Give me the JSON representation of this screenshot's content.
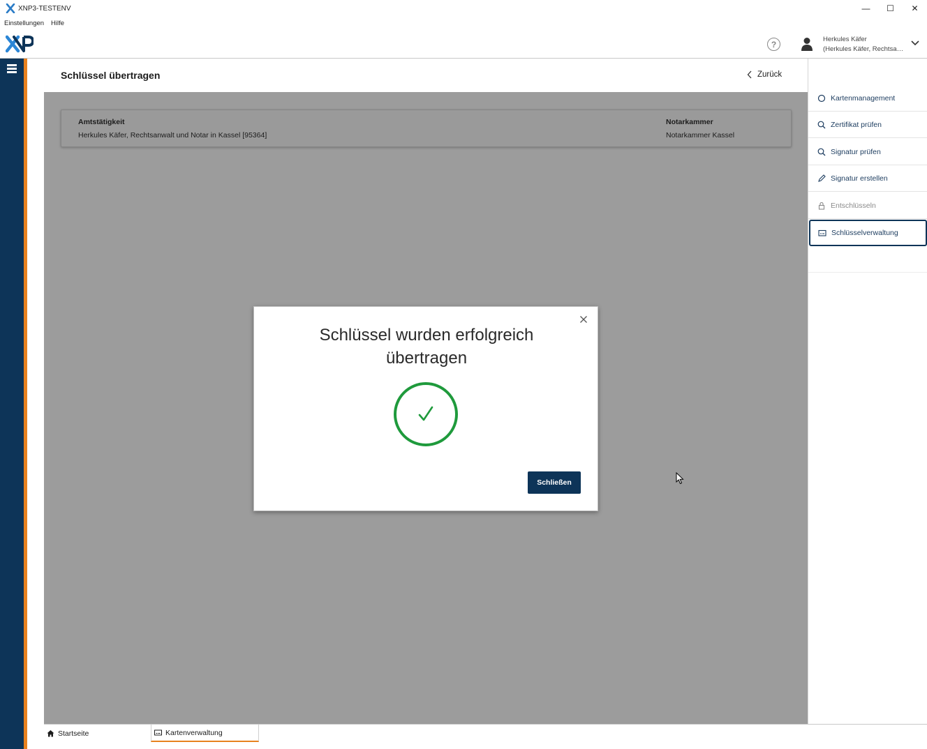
{
  "window": {
    "title": "XNP3-TESTENV",
    "controls": {
      "minimize": "—",
      "maximize": "☐",
      "close": "✕"
    }
  },
  "menu": {
    "items": [
      "Einstellungen",
      "Hilfe"
    ]
  },
  "header": {
    "logo_icon": "xnp-logo",
    "help_icon": "question-circle-icon",
    "user": {
      "name": "Herkules Käfer",
      "role": "(Herkules Käfer, Rechtsa…"
    }
  },
  "page": {
    "title": "Schlüssel übertragen",
    "back_label": "Zurück"
  },
  "info_card": {
    "office_label": "Amtstätigkeit",
    "office_value": "Herkules Käfer, Rechtsanwalt und Notar in Kassel [95364]",
    "chamber_label": "Notarkammer",
    "chamber_value": "Notarkammer Kassel"
  },
  "sidebar": {
    "items": [
      {
        "label": "Kartenmanagement",
        "icon": "circle-icon",
        "state": "normal"
      },
      {
        "label": "Zertifikat prüfen",
        "icon": "search-icon",
        "state": "normal"
      },
      {
        "label": "Signatur prüfen",
        "icon": "search-icon",
        "state": "normal"
      },
      {
        "label": "Signatur erstellen",
        "icon": "pencil-icon",
        "state": "normal"
      },
      {
        "label": "Entschlüsseln",
        "icon": "lock-icon",
        "state": "disabled"
      },
      {
        "label": "Schlüsselverwaltung",
        "icon": "card-icon",
        "state": "active"
      }
    ]
  },
  "bottom_tabs": [
    {
      "label": "Startseite",
      "icon": "home-icon",
      "active": false
    },
    {
      "label": "Kartenverwaltung",
      "icon": "card-icon",
      "active": true
    }
  ],
  "modal": {
    "title": "Schlüssel wurden erfolgreich übertragen",
    "icon": "success-check-icon",
    "button_label": "Schließen"
  },
  "colors": {
    "navy": "#0d3458",
    "orange_accent": "#e8821f",
    "success_green": "#1f9a3c",
    "overlay_gray": "#9c9c9c"
  }
}
